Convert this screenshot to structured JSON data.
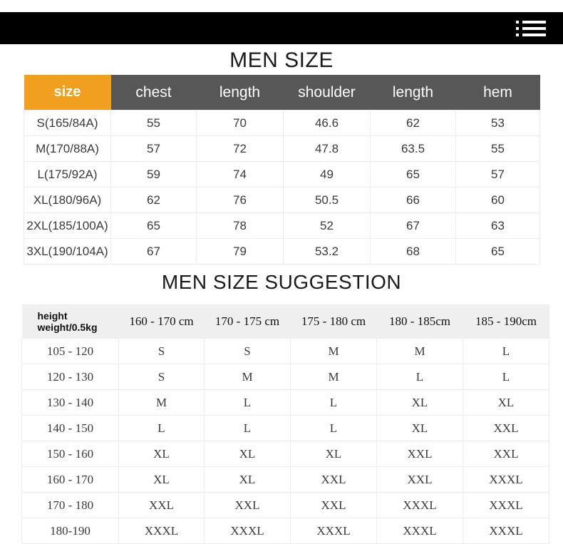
{
  "topbar": {
    "menu_icon": "list-icon",
    "background_color": "#000000"
  },
  "colors": {
    "accent_orange": "#F0A01E",
    "header_gray": "#575757",
    "suggestion_header_gray": "#EFEFEF",
    "topbar_black": "#000000",
    "grid_line": "#ECECEC",
    "body_text": "#3A3A3A"
  },
  "size_table": {
    "title": "MEN SIZE",
    "columns": [
      "size",
      "chest",
      "length",
      "shoulder",
      "length",
      "hem"
    ],
    "rows": [
      {
        "size": "S(165/84A)",
        "chest": "55",
        "length": "70",
        "shoulder": "46.6",
        "length2": "62",
        "hem": "53"
      },
      {
        "size": "M(170/88A)",
        "chest": "57",
        "length": "72",
        "shoulder": "47.8",
        "length2": "63.5",
        "hem": "55"
      },
      {
        "size": "L(175/92A)",
        "chest": "59",
        "length": "74",
        "shoulder": "49",
        "length2": "65",
        "hem": "57"
      },
      {
        "size": "XL(180/96A)",
        "chest": "62",
        "length": "76",
        "shoulder": "50.5",
        "length2": "66",
        "hem": "60"
      },
      {
        "size": "2XL(185/100A)",
        "chest": "65",
        "length": "78",
        "shoulder": "52",
        "length2": "67",
        "hem": "63"
      },
      {
        "size": "3XL(190/104A)",
        "chest": "67",
        "length": "79",
        "shoulder": "53.2",
        "length2": "68",
        "hem": "65"
      }
    ]
  },
  "suggestion_table": {
    "title": "MEN SIZE SUGGESTION",
    "corner_label_line1": "height",
    "corner_label_line2": "weight/0.5kg",
    "columns": [
      "160 - 170 cm",
      "170 - 175 cm",
      "175 - 180 cm",
      "180 - 185cm",
      "185 - 190cm"
    ],
    "rows": [
      {
        "weight": "105 - 120",
        "c1": "S",
        "c2": "S",
        "c3": "M",
        "c4": "M",
        "c5": "L"
      },
      {
        "weight": "120 - 130",
        "c1": "S",
        "c2": "M",
        "c3": "M",
        "c4": "L",
        "c5": "L"
      },
      {
        "weight": "130 - 140",
        "c1": "M",
        "c2": "L",
        "c3": "L",
        "c4": "XL",
        "c5": "XL"
      },
      {
        "weight": "140 - 150",
        "c1": "L",
        "c2": "L",
        "c3": "L",
        "c4": "XL",
        "c5": "XXL"
      },
      {
        "weight": "150 - 160",
        "c1": "XL",
        "c2": "XL",
        "c3": "XL",
        "c4": "XXL",
        "c5": "XXL"
      },
      {
        "weight": "160 - 170",
        "c1": "XL",
        "c2": "XL",
        "c3": "XXL",
        "c4": "XXL",
        "c5": "XXXL"
      },
      {
        "weight": "170 - 180",
        "c1": "XXL",
        "c2": "XXL",
        "c3": "XXL",
        "c4": "XXXL",
        "c5": "XXXL"
      },
      {
        "weight": "180-190",
        "c1": "XXXL",
        "c2": "XXXL",
        "c3": "XXXL",
        "c4": "XXXL",
        "c5": "XXXL"
      }
    ]
  }
}
